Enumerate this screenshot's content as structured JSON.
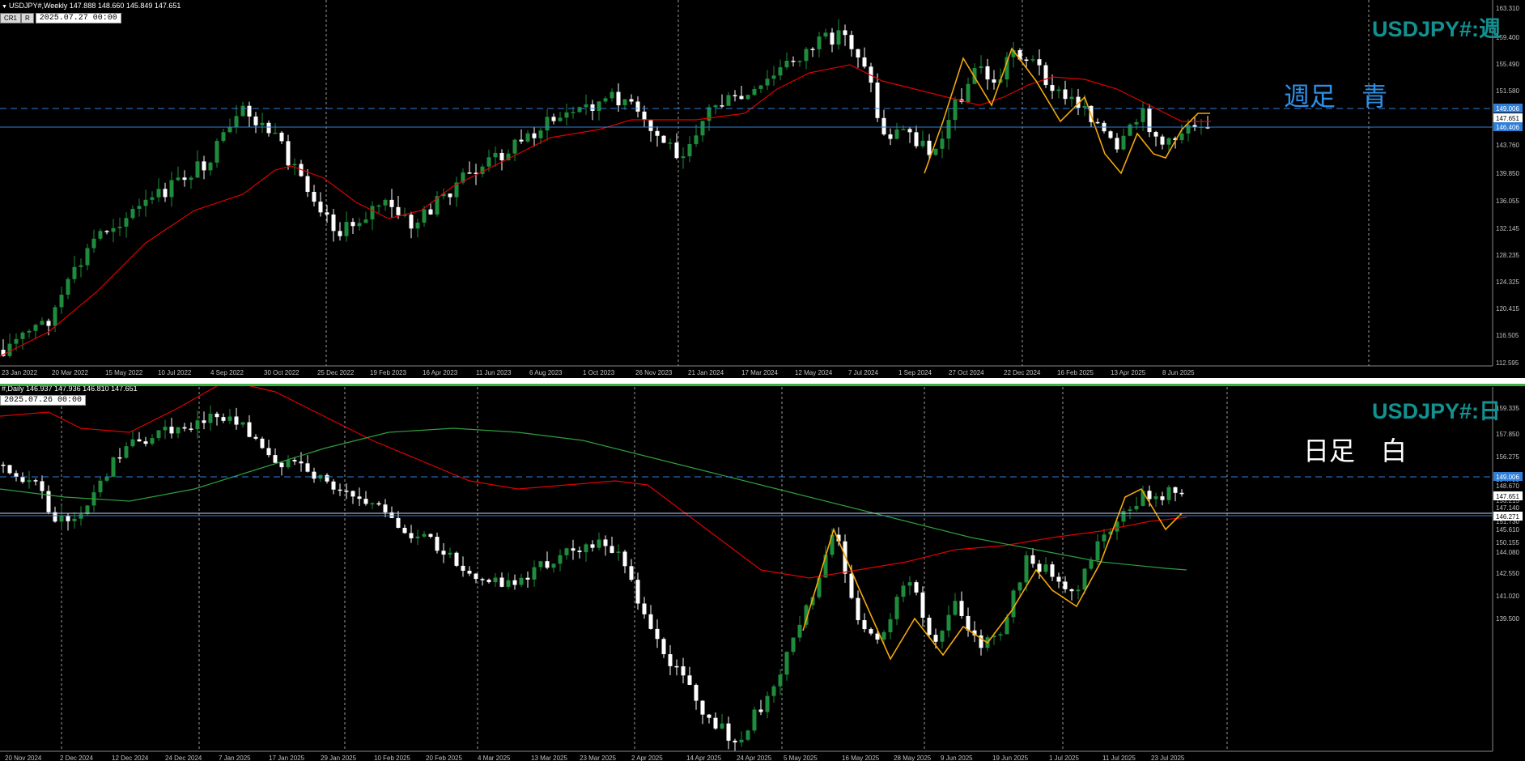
{
  "colors": {
    "background": "#000000",
    "candle_up": "#1e8c3c",
    "candle_down": "#ffffff",
    "ma_red": "#e00000",
    "ma_green": "#2e9e3e",
    "zigzag": "#f4a80a",
    "hline": "#2f7fd8",
    "title": "#139191",
    "axis_text": "#c0c0c0"
  },
  "weekly": {
    "symbol_info": "USDJPY#,Weekly  147.888 148.660 145.849 147.651",
    "toolbar_buttons": [
      "CR1",
      "R"
    ],
    "date_box": "2025.07.27 00:00",
    "title": "USDJPY#:週",
    "note": "週足　青",
    "price_labels": [
      "163.310",
      "159.400",
      "155.490",
      "151.580",
      "149.006",
      "147.651",
      "146.406",
      "143.760",
      "139.850",
      "136.055",
      "132.145",
      "128.235",
      "124.325",
      "120.415",
      "116.505",
      "112.595"
    ],
    "time_labels": [
      "23 Jan 2022",
      "20 Mar 2022",
      "15 May 2022",
      "10 Jul 2022",
      "4 Sep 2022",
      "30 Oct 2022",
      "25 Dec 2022",
      "19 Feb 2023",
      "16 Apr 2023",
      "11 Jun 2023",
      "6 Aug 2023",
      "1 Oct 2023",
      "26 Nov 2023",
      "21 Jan 2024",
      "17 Mar 2024",
      "12 May 2024",
      "7 Jul 2024",
      "1 Sep 2024",
      "27 Oct 2024",
      "22 Dec 2024",
      "16 Feb 2025",
      "13 Apr 2025",
      "8 Jun 2025"
    ]
  },
  "daily": {
    "symbol_info": "#,Daily  146.937 147.936 146.810 147.651",
    "date_box": "2025.07.26 00:00",
    "title": "USDJPY#:日",
    "note": "日足　白",
    "price_labels": [
      "159.335",
      "157.850",
      "156.275",
      "154.790",
      "153.215",
      "151.730",
      "150.155",
      "149.006",
      "148.670",
      "147.651",
      "147.140",
      "146.271",
      "145.610",
      "144.080",
      "142.550",
      "141.020",
      "139.500"
    ],
    "time_labels": [
      "20 Nov 2024",
      "2 Dec 2024",
      "12 Dec 2024",
      "24 Dec 2024",
      "7 Jan 2025",
      "17 Jan 2025",
      "29 Jan 2025",
      "10 Feb 2025",
      "20 Feb 2025",
      "4 Mar 2025",
      "13 Mar 2025",
      "23 Mar 2025",
      "2 Apr 2025",
      "14 Apr 2025",
      "24 Apr 2025",
      "5 May 2025",
      "16 May 2025",
      "28 May 2025",
      "9 Jun 2025",
      "19 Jun 2025",
      "1 Jul 2025",
      "11 Jul 2025",
      "23 Jul 2025"
    ]
  }
}
